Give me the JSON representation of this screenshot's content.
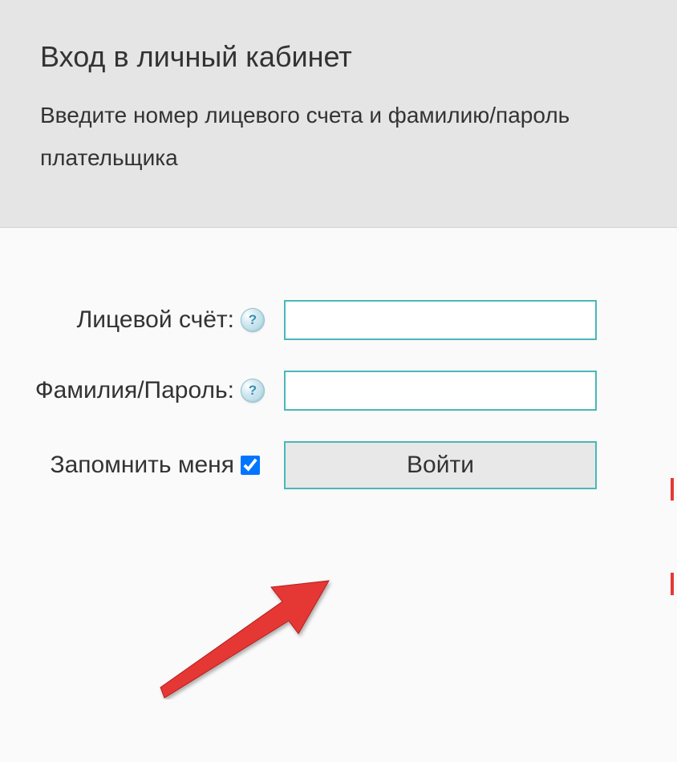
{
  "header": {
    "title": "Вход в личный кабинет",
    "subtitle": "Введите номер лицевого счета и фамилию/пароль плательщика"
  },
  "form": {
    "account_label": "Лицевой счёт:",
    "account_value": "",
    "password_label": "Фамилия/Пароль:",
    "password_value": "",
    "remember_label": "Запомнить меня",
    "submit_label": "Войти",
    "help_symbol": "?"
  }
}
